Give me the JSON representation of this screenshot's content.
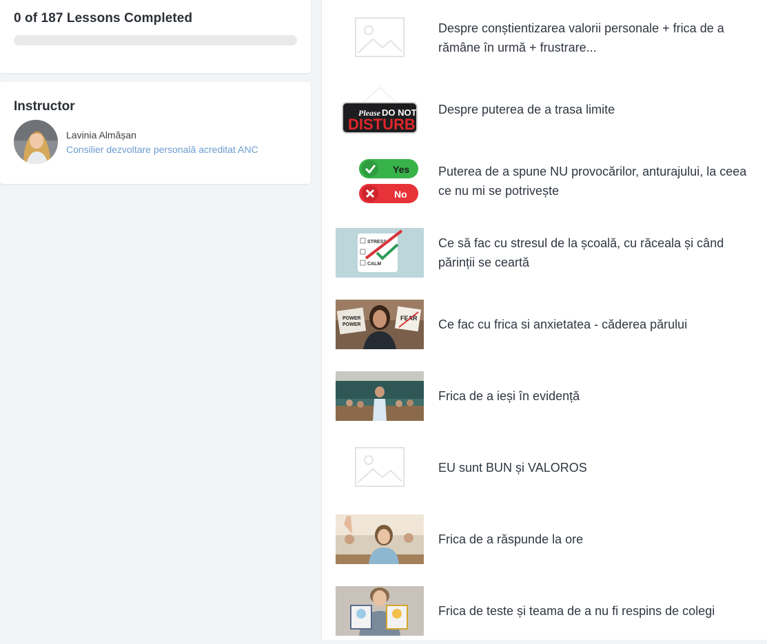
{
  "progress": {
    "title": "0 of 187 Lessons Completed",
    "completed": 0,
    "total": 187,
    "fill_color": "#3b82c4"
  },
  "instructor": {
    "heading": "Instructor",
    "name": "Lavinia Almășan",
    "role": "Consilier dezvoltare personală acreditat ANC"
  },
  "lessons": [
    {
      "title": "Despre conștientizarea valorii personale + frica de a rămâne în urmă + frustrare...",
      "thumb": "placeholder-image-icon"
    },
    {
      "title": "Despre puterea de a trasa limite",
      "thumb": "do-not-disturb-sign"
    },
    {
      "title": "Puterea de a spune NU provocărilor, anturajului, la ceea ce nu mi se potrivește",
      "thumb": "yes-no-buttons"
    },
    {
      "title": "Ce să fac cu stresul de la școală, cu răceala și când părinții se ceartă",
      "thumb": "stress-calm-checklist"
    },
    {
      "title": "Ce fac cu frica si anxietatea - căderea părului",
      "thumb": "girl-power-fear-signs"
    },
    {
      "title": "Frica de a ieși în evidență",
      "thumb": "classroom-student-standing"
    },
    {
      "title": "EU sunt BUN și VALOROS",
      "thumb": "placeholder-image-icon"
    },
    {
      "title": "Frica de a răspunde la ore",
      "thumb": "student-raising-hand"
    },
    {
      "title": "Frica de teste și teama de a nu fi respins de colegi",
      "thumb": "boy-holding-cards"
    }
  ],
  "thumb_texts": {
    "dnd_please": "Please",
    "dnd_do_not": "DO NOT",
    "dnd_disturb": "DISTURB",
    "yes": "Yes",
    "no": "No",
    "stress": "STRESS",
    "calm": "CALM",
    "power": "POWER",
    "fear": "FEAR"
  }
}
